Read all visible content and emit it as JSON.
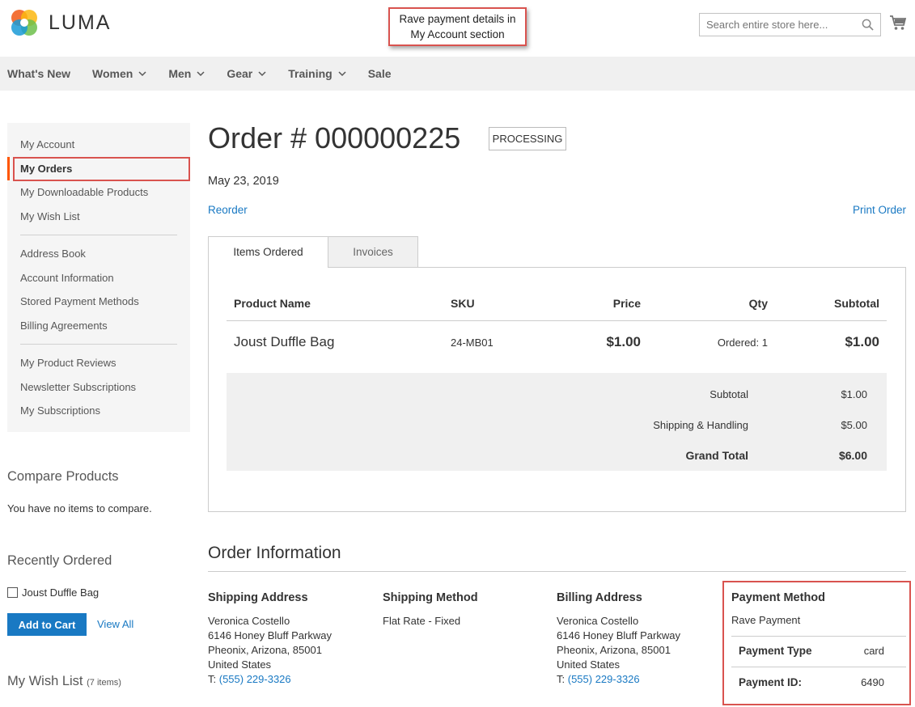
{
  "header": {
    "logo_text": "LUMA",
    "search_placeholder": "Search entire store here...",
    "callout": {
      "line1": "Rave payment details in",
      "line2": "My Account section"
    }
  },
  "nav": {
    "items": [
      {
        "label": "What's New",
        "has_dropdown": false
      },
      {
        "label": "Women",
        "has_dropdown": true
      },
      {
        "label": "Men",
        "has_dropdown": true
      },
      {
        "label": "Gear",
        "has_dropdown": true
      },
      {
        "label": "Training",
        "has_dropdown": true
      },
      {
        "label": "Sale",
        "has_dropdown": false
      }
    ]
  },
  "sidebar": {
    "group1": [
      "My Account",
      "My Orders",
      "My Downloadable Products",
      "My Wish List"
    ],
    "group2": [
      "Address Book",
      "Account Information",
      "Stored Payment Methods",
      "Billing Agreements"
    ],
    "group3": [
      "My Product Reviews",
      "Newsletter Subscriptions",
      "My Subscriptions"
    ],
    "active": "My Orders",
    "compare_title": "Compare Products",
    "compare_text": "You have no items to compare.",
    "recent_title": "Recently Ordered",
    "recent_item": "Joust Duffle Bag",
    "add_to_cart": "Add to Cart",
    "view_all": "View All",
    "wish_title": "My Wish List",
    "wish_count": "(7 items)"
  },
  "order": {
    "title": "Order # 000000225",
    "status": "PROCESSING",
    "date": "May 23, 2019",
    "reorder": "Reorder",
    "print": "Print Order",
    "tabs": [
      "Items Ordered",
      "Invoices"
    ],
    "columns": {
      "product": "Product Name",
      "sku": "SKU",
      "price": "Price",
      "qty": "Qty",
      "subtotal": "Subtotal"
    },
    "item": {
      "name": "Joust Duffle Bag",
      "sku": "24-MB01",
      "price": "$1.00",
      "qty": "Ordered: 1",
      "subtotal": "$1.00"
    },
    "totals": {
      "subtotal_label": "Subtotal",
      "subtotal_value": "$1.00",
      "shipping_label": "Shipping & Handling",
      "shipping_value": "$5.00",
      "grand_label": "Grand Total",
      "grand_value": "$6.00"
    }
  },
  "order_info": {
    "title": "Order Information",
    "shipping_address": {
      "title": "Shipping Address",
      "name": "Veronica Costello",
      "street": "6146 Honey Bluff Parkway",
      "city": "Pheonix, Arizona, 85001",
      "country": "United States",
      "phone_prefix": "T: ",
      "phone": "(555) 229-3326"
    },
    "shipping_method": {
      "title": "Shipping Method",
      "value": "Flat Rate - Fixed"
    },
    "billing_address": {
      "title": "Billing Address",
      "name": "Veronica Costello",
      "street": "6146 Honey Bluff Parkway",
      "city": "Pheonix, Arizona, 85001",
      "country": "United States",
      "phone_prefix": "T: ",
      "phone": "(555) 229-3326"
    },
    "payment": {
      "title": "Payment Method",
      "name": "Rave Payment",
      "type_label": "Payment Type",
      "type_value": "card",
      "id_label": "Payment ID:",
      "id_value": "6490"
    }
  },
  "colors": {
    "link": "#1979c3",
    "accent": "#ff5501",
    "highlight_box": "#d9534f",
    "button": "#1979c3"
  }
}
